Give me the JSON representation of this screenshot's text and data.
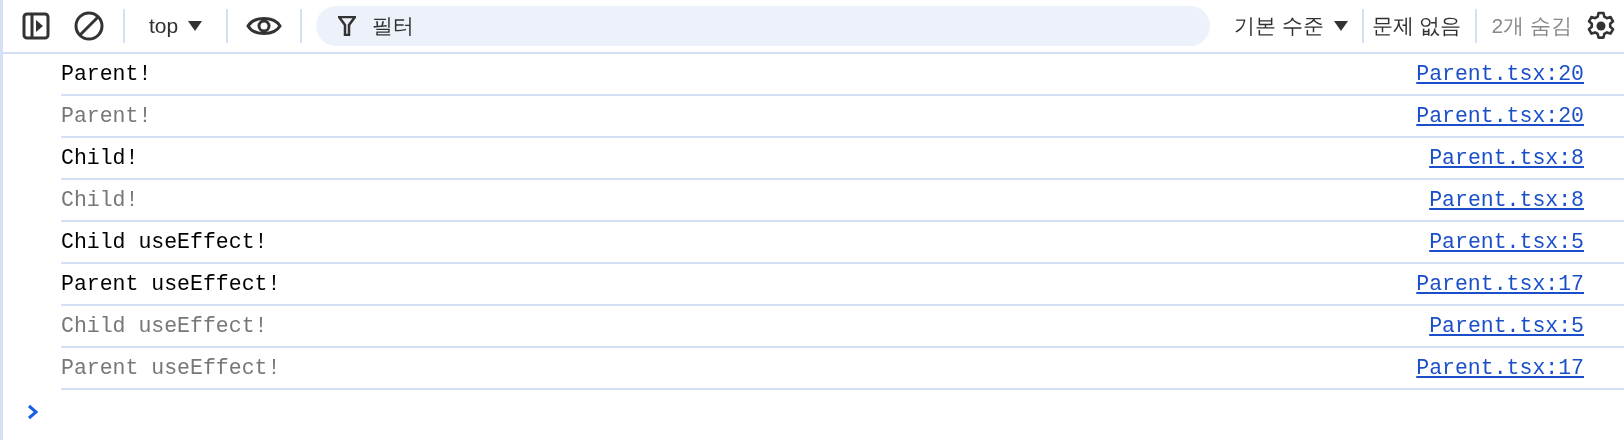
{
  "toolbar": {
    "context": "top",
    "filter": {
      "placeholder": "필터"
    },
    "levels": "기본 수준",
    "issues": "문제 없음",
    "hidden": "2개 숨김"
  },
  "messages": [
    {
      "text": "Parent!",
      "source": "Parent.tsx:20",
      "dimmed": false
    },
    {
      "text": "Parent!",
      "source": "Parent.tsx:20",
      "dimmed": true
    },
    {
      "text": "Child!",
      "source": "Parent.tsx:8",
      "dimmed": false
    },
    {
      "text": "Child!",
      "source": "Parent.tsx:8",
      "dimmed": true
    },
    {
      "text": "Child useEffect!",
      "source": "Parent.tsx:5",
      "dimmed": false
    },
    {
      "text": "Parent useEffect!",
      "source": "Parent.tsx:17",
      "dimmed": false
    },
    {
      "text": "Child useEffect!",
      "source": "Parent.tsx:5",
      "dimmed": true
    },
    {
      "text": "Parent useEffect!",
      "source": "Parent.tsx:17",
      "dimmed": true
    }
  ]
}
